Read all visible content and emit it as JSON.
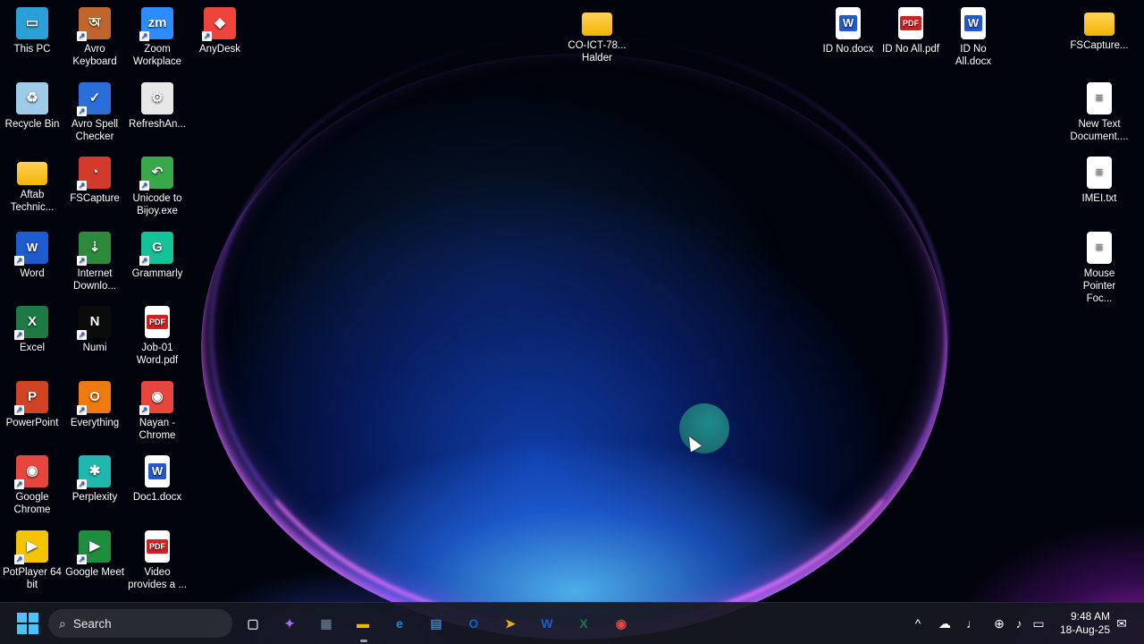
{
  "desktop": {
    "col1": [
      {
        "label": "This PC",
        "icon": "monitor-icon",
        "color": "#2a9fd8"
      },
      {
        "label": "Recycle Bin",
        "icon": "recycle-bin-icon",
        "color": "#9ecbe8"
      },
      {
        "label": "Aftab Technic...",
        "icon": "folder-icon",
        "color": "#f4b400"
      },
      {
        "label": "Word",
        "icon": "word-icon",
        "color": "#1e5bd0"
      },
      {
        "label": "Excel",
        "icon": "excel-icon",
        "color": "#1d7a45"
      },
      {
        "label": "PowerPoint",
        "icon": "powerpoint-icon",
        "color": "#d04423"
      },
      {
        "label": "Google Chrome",
        "icon": "chrome-icon",
        "color": "#e8453c"
      },
      {
        "label": "PotPlayer 64 bit",
        "icon": "potplayer-icon",
        "color": "#f5c400"
      }
    ],
    "col2": [
      {
        "label": "Avro Keyboard",
        "icon": "avro-keyboard-icon",
        "color": "#c0662c"
      },
      {
        "label": "Avro Spell Checker",
        "icon": "spell-checker-icon",
        "color": "#2a6fd8"
      },
      {
        "label": "FSCapture",
        "icon": "fscapture-icon",
        "color": "#d33a2c"
      },
      {
        "label": "Internet Downlo...",
        "icon": "idm-icon",
        "color": "#2c8a3a"
      },
      {
        "label": "Numi",
        "icon": "numi-icon",
        "color": "#111111"
      },
      {
        "label": "Everything",
        "icon": "everything-icon",
        "color": "#f07a10"
      },
      {
        "label": "Perplexity",
        "icon": "perplexity-icon",
        "color": "#1fb8b0"
      },
      {
        "label": "Google Meet",
        "icon": "google-meet-icon",
        "color": "#1e8e3e"
      }
    ],
    "col3": [
      {
        "label": "Zoom Workplace",
        "icon": "zoom-icon",
        "color": "#2d8cff"
      },
      {
        "label": "RefreshAn...",
        "icon": "refresh-icon",
        "color": "#e8e8e8"
      },
      {
        "label": "Unicode to Bijoy.exe",
        "icon": "unicode-bijoy-icon",
        "color": "#3aa84a"
      },
      {
        "label": "Grammarly",
        "icon": "grammarly-icon",
        "color": "#15c39a"
      },
      {
        "label": "Job-01 Word.pdf",
        "icon": "pdf-icon",
        "color": "#d32020"
      },
      {
        "label": "Nayan - Chrome",
        "icon": "chrome-profile-icon",
        "color": "#e8453c"
      },
      {
        "label": "Doc1.docx",
        "icon": "docx-icon",
        "color": "#1e5bd0"
      },
      {
        "label": "Video provides a ...",
        "icon": "pdf-icon",
        "color": "#d32020"
      }
    ],
    "col4": [
      {
        "label": "AnyDesk",
        "icon": "anydesk-icon",
        "color": "#ef443b"
      }
    ],
    "center": [
      {
        "label": "CO-ICT-78... Halder",
        "icon": "folder-icon",
        "color": "#f4b400"
      }
    ],
    "right_top": [
      {
        "label": "ID No.docx",
        "icon": "docx-icon",
        "color": "#1e5bd0"
      },
      {
        "label": "ID No All.pdf",
        "icon": "pdf-icon",
        "color": "#d32020"
      },
      {
        "label": "ID No All.docx",
        "icon": "docx-icon",
        "color": "#1e5bd0"
      }
    ],
    "right_col": [
      {
        "label": "FSCapture...",
        "icon": "folder-icon",
        "color": "#f4b400"
      },
      {
        "label": "New Text Document....",
        "icon": "text-file-icon",
        "color": "#ffffff"
      },
      {
        "label": "IMEI.txt",
        "icon": "text-file-icon",
        "color": "#ffffff"
      },
      {
        "label": "Mouse Pointer Foc...",
        "icon": "text-file-icon",
        "color": "#ffffff"
      }
    ]
  },
  "taskbar": {
    "search_placeholder": "Search",
    "pinned": [
      {
        "name": "task-view-icon",
        "glyph": "▢",
        "color": "#cfd3da"
      },
      {
        "name": "copilot-icon",
        "glyph": "✦",
        "color": "#a46cf0"
      },
      {
        "name": "calculator-icon",
        "glyph": "▦",
        "color": "#5b6b82"
      },
      {
        "name": "file-explorer-icon",
        "glyph": "▬",
        "color": "#f4b400"
      },
      {
        "name": "edge-icon",
        "glyph": "e",
        "color": "#1f8ad8"
      },
      {
        "name": "microsoft-store-icon",
        "glyph": "▤",
        "color": "#2f7de1"
      },
      {
        "name": "outlook-icon",
        "glyph": "O",
        "color": "#0a64c8"
      },
      {
        "name": "pointer-tool-icon",
        "glyph": "➤",
        "color": "#e0b21a"
      },
      {
        "name": "word-taskbar-icon",
        "glyph": "W",
        "color": "#1e5bd0"
      },
      {
        "name": "excel-taskbar-icon",
        "glyph": "X",
        "color": "#1d7a45"
      },
      {
        "name": "chrome-taskbar-icon",
        "glyph": "◉",
        "color": "#e8453c"
      }
    ],
    "clock_time": "9:48 AM",
    "clock_date": "18-Aug-25"
  }
}
